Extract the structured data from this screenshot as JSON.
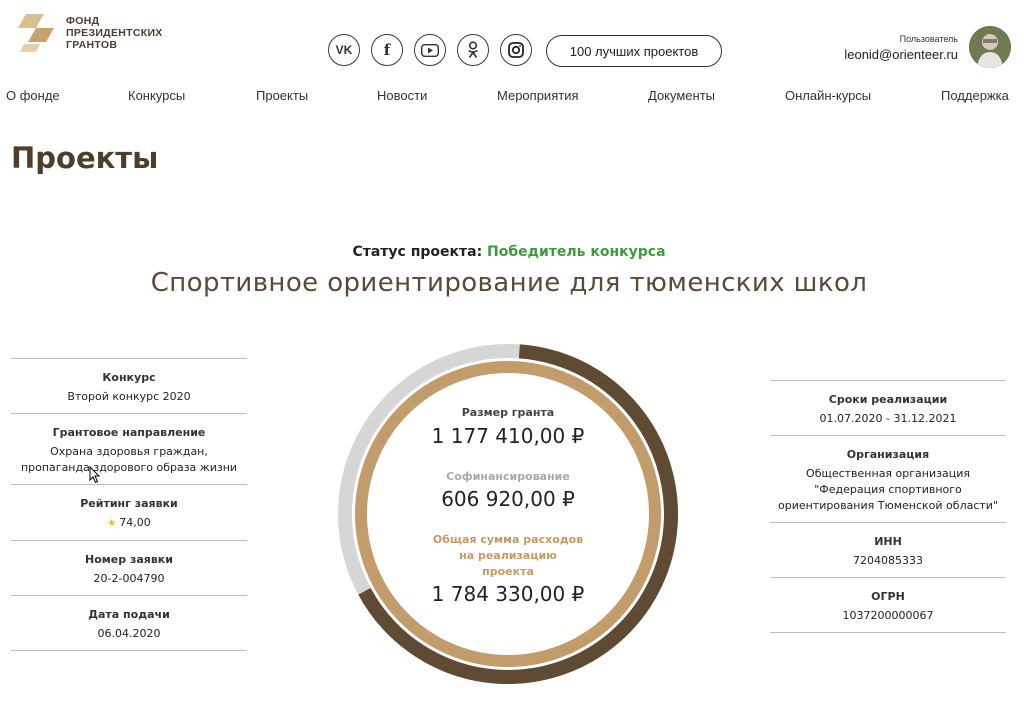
{
  "header": {
    "logo_lines": [
      "ФОНД",
      "ПРЕЗИДЕНТСКИХ",
      "ГРАНТОВ"
    ],
    "social_icons": [
      "vk-icon",
      "facebook-icon",
      "youtube-icon",
      "odnoklassniki-icon",
      "instagram-icon"
    ],
    "social_glyphs": [
      "VK",
      "f",
      "▶",
      "ok",
      "◎"
    ],
    "top_projects_button": "100 лучших проектов",
    "user_label": "Пользователь",
    "user_email": "leonid@orienteer.ru"
  },
  "nav": {
    "items": [
      "О фонде",
      "Конкурсы",
      "Проекты",
      "Новости",
      "Мероприятия",
      "Документы",
      "Онлайн-курсы",
      "Поддержка"
    ]
  },
  "page": {
    "title": "Проекты",
    "status_label": "Статус проекта:",
    "status_value": "Победитель конкурса",
    "project_title": "Спортивное ориентирование для тюменских школ"
  },
  "left": {
    "contest_label": "Конкурс",
    "contest_value": "Второй конкурс 2020",
    "direction_label": "Грантовое направление",
    "direction_value": "Охрана здоровья граждан, пропаганда здорового образа жизни",
    "rating_label": "Рейтинг заявки",
    "rating_value": "74,00",
    "number_label": "Номер заявки",
    "number_value": "20-2-004790",
    "date_label": "Дата подачи",
    "date_value": "06.04.2020"
  },
  "ring": {
    "grant_label": "Размер гранта",
    "grant_value": "1 177 410,00 ₽",
    "cofin_label": "Софинансирование",
    "cofin_value": "606 920,00 ₽",
    "total_label": "Общая сумма расходов на реализацию проекта",
    "total_value": "1 784 330,00 ₽",
    "grant_share": 0.66,
    "colors": {
      "grant": "#5f4a33",
      "cofin": "#d6d6d6",
      "inner": "#c29c6b"
    }
  },
  "right": {
    "period_label": "Сроки реализации",
    "period_value": "01.07.2020 - 31.12.2021",
    "org_label": "Организация",
    "org_value": "Общественная организация \"Федерация спортивного ориентирования Тюменской области\"",
    "inn_label": "ИНН",
    "inn_value": "7204085333",
    "ogrn_label": "ОГРН",
    "ogrn_value": "1037200000067"
  }
}
